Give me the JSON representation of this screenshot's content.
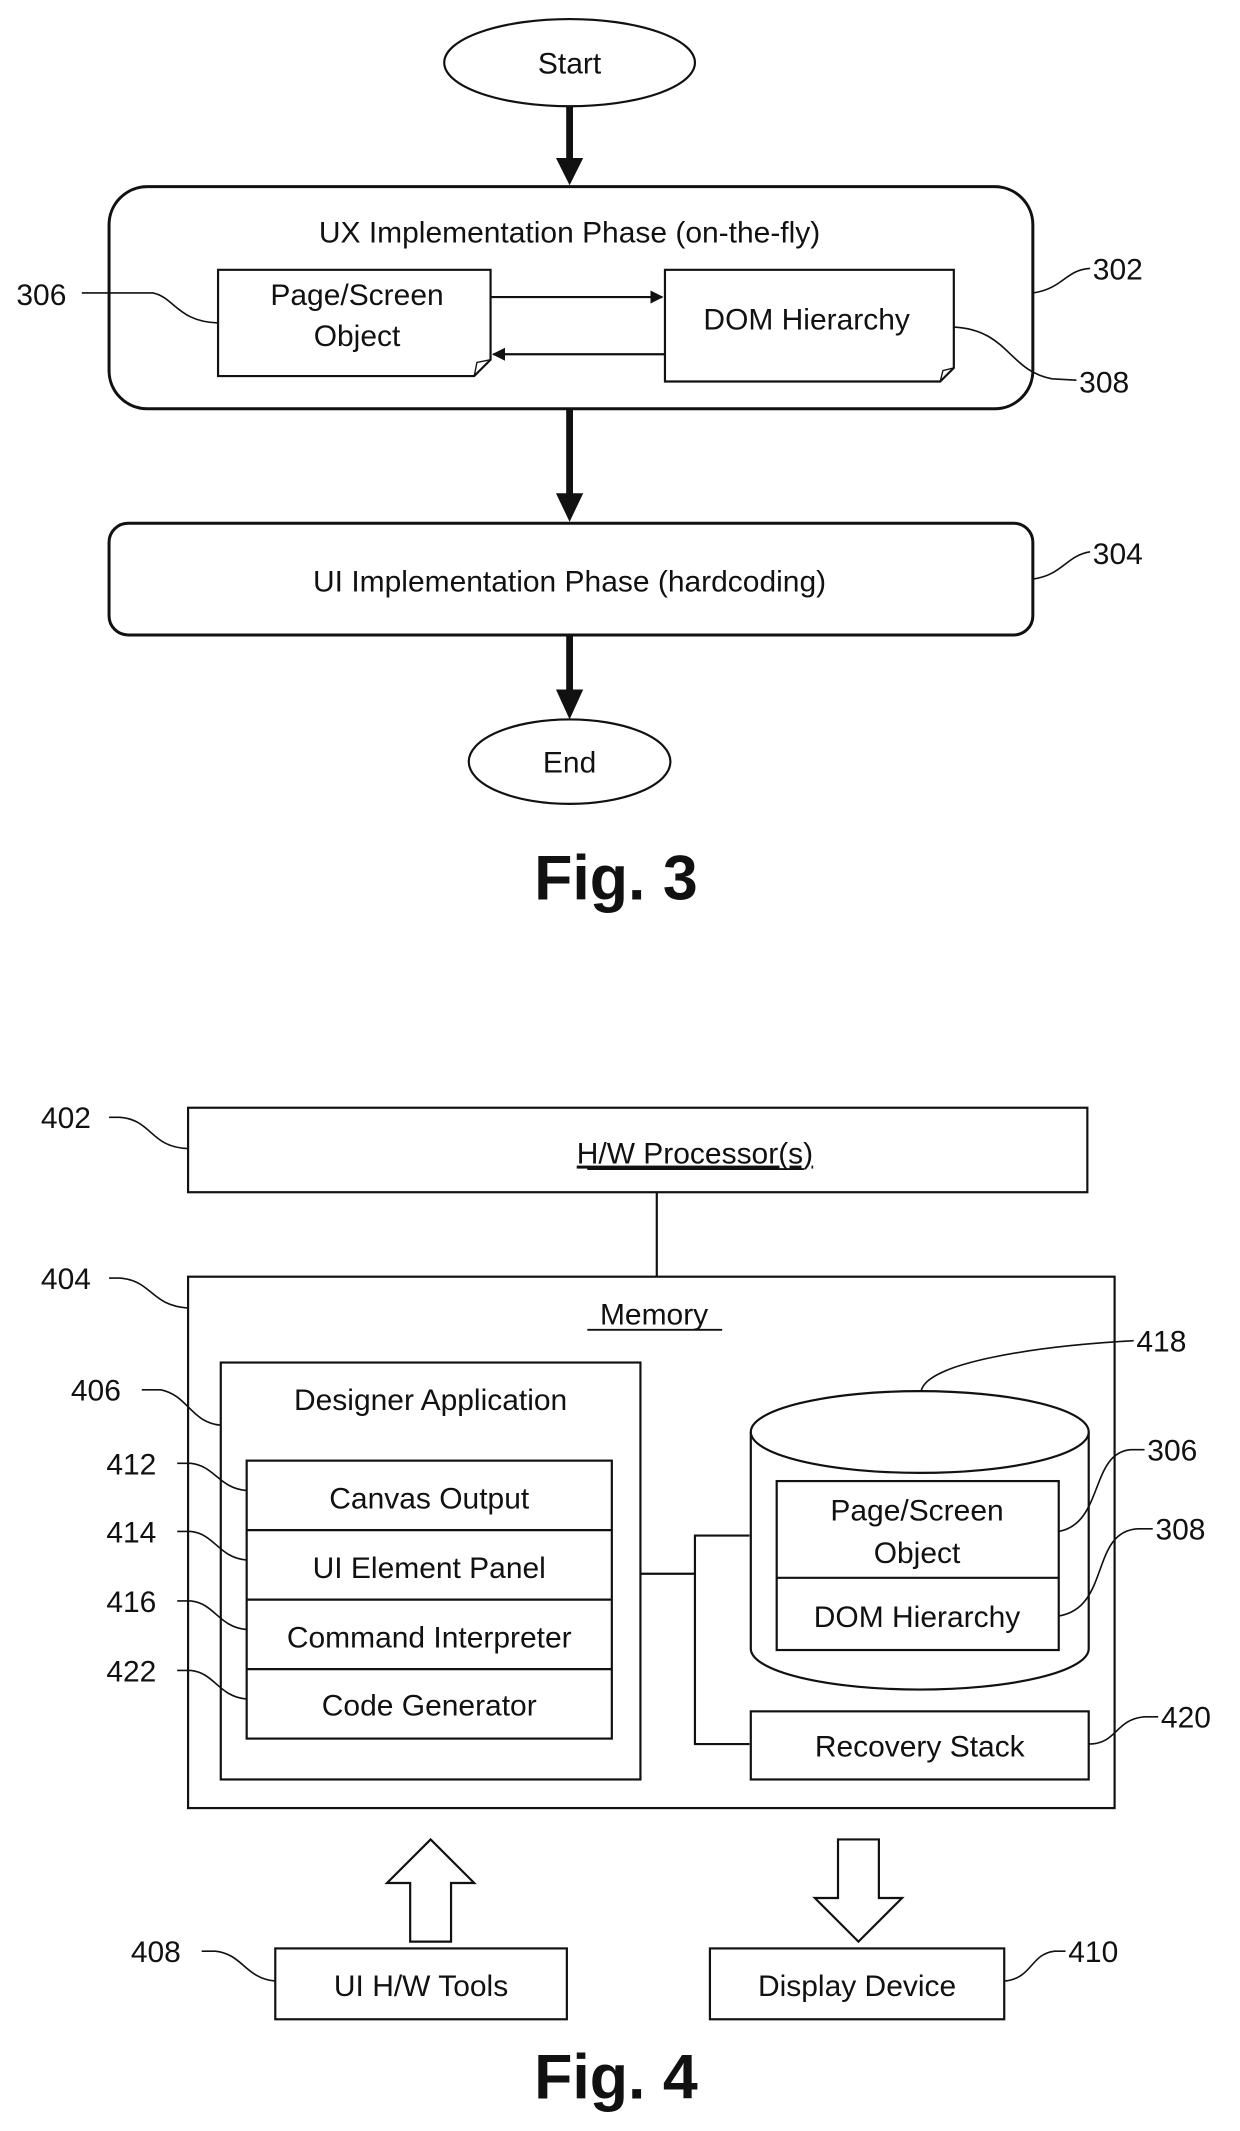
{
  "fig3": {
    "caption": "Fig. 3",
    "start": "Start",
    "end": "End",
    "ux_phase": {
      "title": "UX Implementation Phase (on-the-fly)",
      "ref": "302"
    },
    "page_object": {
      "line1": "Page/Screen",
      "line2": "Object",
      "ref": "306"
    },
    "dom": {
      "label": "DOM Hierarchy",
      "ref": "308"
    },
    "ui_phase": {
      "title": "UI Implementation Phase (hardcoding)",
      "ref": "304"
    }
  },
  "fig4": {
    "caption": "Fig. 4",
    "processor": {
      "label": "H/W Processor(s)",
      "ref": "402"
    },
    "memory": {
      "label": "Memory",
      "ref": "404"
    },
    "designer": {
      "title": "Designer Application",
      "ref": "406",
      "items": [
        {
          "label": "Canvas Output",
          "ref": "412"
        },
        {
          "label": "UI Element Panel",
          "ref": "414"
        },
        {
          "label": "Command Interpreter",
          "ref": "416"
        },
        {
          "label": "Code Generator",
          "ref": "422"
        }
      ]
    },
    "database": {
      "ref": "418",
      "page_object": {
        "line1": "Page/Screen",
        "line2": "Object",
        "ref": "306"
      },
      "dom": {
        "label": "DOM Hierarchy",
        "ref": "308"
      }
    },
    "recovery": {
      "label": "Recovery Stack",
      "ref": "420"
    },
    "ui_tools": {
      "label": "UI H/W Tools",
      "ref": "408"
    },
    "display": {
      "label": "Display Device",
      "ref": "410"
    }
  }
}
